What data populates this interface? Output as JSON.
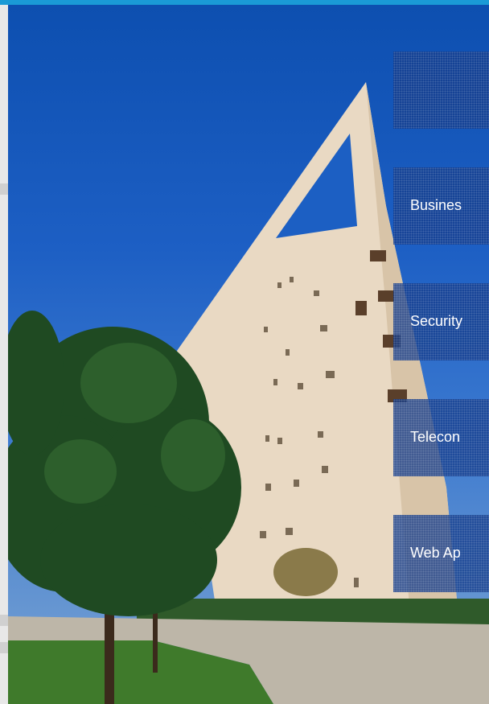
{
  "nav": {
    "items": [
      {
        "label": ""
      },
      {
        "label": "Busines"
      },
      {
        "label": "Security"
      },
      {
        "label": "Telecon"
      },
      {
        "label": "Web Ap"
      }
    ]
  },
  "colors": {
    "accent_bar": "#1a9ad6",
    "tile_overlay": "#163e8c",
    "sky_top": "#0d4fb0"
  }
}
